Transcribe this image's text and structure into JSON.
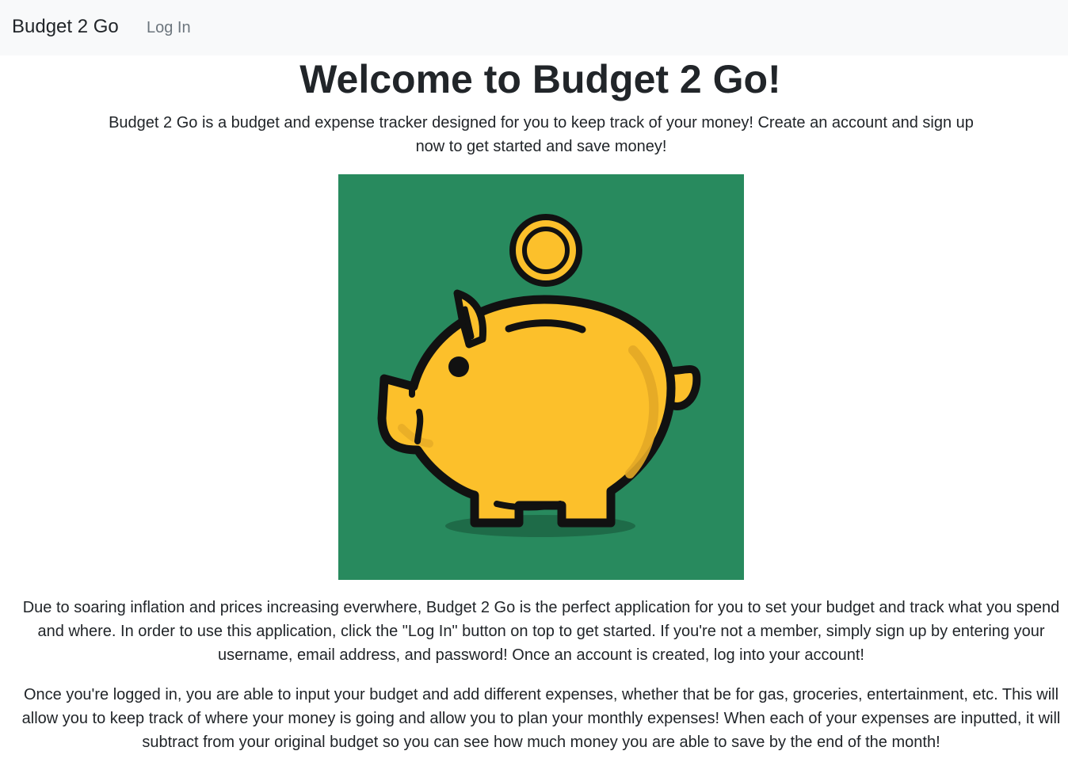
{
  "navbar": {
    "brand": "Budget 2 Go",
    "login_link": "Log In"
  },
  "main": {
    "title": "Welcome to Budget 2 Go!",
    "intro": "Budget 2 Go is a budget and expense tracker designed for you to keep track of your money! Create an account and sign up now to get started and save money!",
    "hero_image": {
      "icon": "piggy-bank-icon",
      "background_color": "#288a5e",
      "pig_color": "#fcc02b",
      "coin_color": "#fcc02b"
    },
    "paragraph_1": "Due to soaring inflation and prices increasing everwhere, Budget 2 Go is the perfect application for you to set your budget and track what you spend and where. In order to use this application, click the \"Log In\" button on top to get started. If you're not a member, simply sign up by entering your username, email address, and password! Once an account is created, log into your account!",
    "paragraph_2": "Once you're logged in, you are able to input your budget and add different expenses, whether that be for gas, groceries, entertainment, etc. This will allow you to keep track of where your money is going and allow you to plan your monthly expenses! When each of your expenses are inputted, it will subtract from your original budget so you can see how much money you are able to save by the end of the month!"
  }
}
